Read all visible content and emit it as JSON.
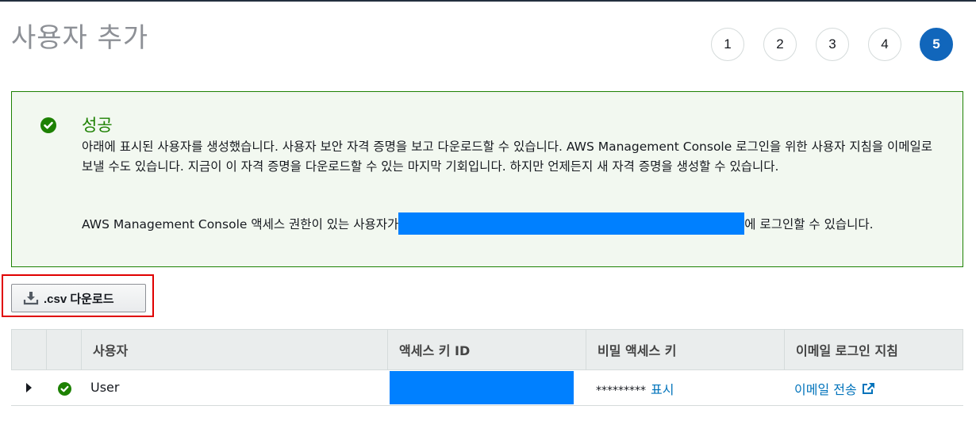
{
  "page": {
    "title": "사용자 추가"
  },
  "steps": [
    {
      "label": "1",
      "active": false
    },
    {
      "label": "2",
      "active": false
    },
    {
      "label": "3",
      "active": false
    },
    {
      "label": "4",
      "active": false
    },
    {
      "label": "5",
      "active": true
    }
  ],
  "alert": {
    "title": "성공",
    "body": "아래에 표시된 사용자를 생성했습니다. 사용자 보안 자격 증명을 보고 다운로드할 수 있습니다. AWS Management Console 로그인을 위한 사용자 지침을 이메일로 보낼 수도 있습니다. 지금이 이 자격 증명을 다운로드할 수 있는 마지막 기회입니다. 하지만 언제든지 새 자격 증명을 생성할 수 있습니다.",
    "console_prefix": "AWS Management Console 액세스 권한이 있는 사용자가",
    "console_suffix": "에 로그인할 수 있습니다."
  },
  "download_button": {
    "label": ".csv 다운로드",
    "icon": "download-icon"
  },
  "table": {
    "headers": [
      "사용자",
      "액세스 키 ID",
      "비밀 액세스 키",
      "이메일 로그인 지침"
    ],
    "rows": [
      {
        "user": "User",
        "secret_mask": "*********",
        "show_label": "표시",
        "email_label": "이메일 전송"
      }
    ]
  },
  "colors": {
    "success": "#1d8102",
    "link": "#0073bb",
    "active_step": "#1166bb",
    "redaction": "#0080ff",
    "highlight": "#e00000"
  }
}
